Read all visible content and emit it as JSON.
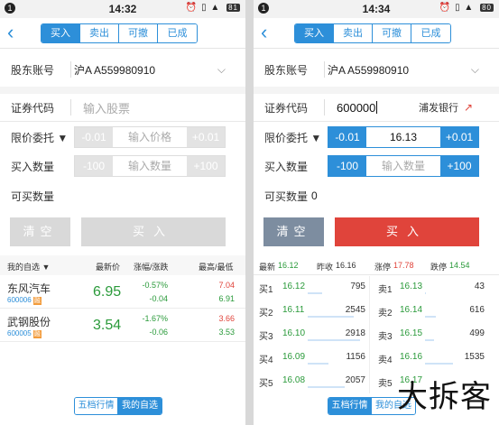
{
  "left": {
    "status": {
      "time": "14:32",
      "battery": "81"
    },
    "tabs": [
      "买入",
      "卖出",
      "可撤",
      "已成"
    ],
    "account_label": "股东账号",
    "account_value": "沪A A559980910",
    "code_label": "证券代码",
    "code_placeholder": "输入股票",
    "limit_label": "限价委托 ▼",
    "price_minus": "-0.01",
    "price_placeholder": "输入价格",
    "price_plus": "+0.01",
    "qty_label": "买入数量",
    "qty_minus": "-100",
    "qty_placeholder": "输入数量",
    "qty_plus": "+100",
    "avail_label": "可买数量",
    "clear_label": "清空",
    "buy_label": "买入",
    "watchlist": {
      "header": {
        "mine": "我的自选 ▼",
        "latest": "最新价",
        "change": "涨幅/涨跌",
        "highlow": "最高/最低"
      },
      "rows": [
        {
          "name": "东风汽车",
          "code": "600006",
          "badge": "融",
          "price": "6.95",
          "pct": "-0.57%",
          "chg": "-0.04",
          "high": "7.04",
          "low": "6.91"
        },
        {
          "name": "武钢股份",
          "code": "600005",
          "badge": "融",
          "price": "3.54",
          "pct": "-1.67%",
          "chg": "-0.06",
          "high": "3.66",
          "low": "3.53"
        }
      ]
    },
    "bottom_tabs": [
      "五档行情",
      "我的自选"
    ]
  },
  "right": {
    "status": {
      "time": "14:34",
      "battery": "80"
    },
    "tabs": [
      "买入",
      "卖出",
      "可撤",
      "已成"
    ],
    "account_label": "股东账号",
    "account_value": "沪A A559980910",
    "code_label": "证券代码",
    "code_value": "600000",
    "stock_name": "浦发银行",
    "limit_label": "限价委托 ▼",
    "price_minus": "-0.01",
    "price_value": "16.13",
    "price_plus": "+0.01",
    "qty_label": "买入数量",
    "qty_minus": "-100",
    "qty_placeholder": "输入数量",
    "qty_plus": "+100",
    "avail_label": "可买数量",
    "avail_value": "0",
    "clear_label": "清空",
    "buy_label": "买入",
    "quote": {
      "latest_label": "最新",
      "latest": "16.12",
      "prev_label": "昨收",
      "prev": "16.16",
      "up_label": "涨停",
      "up": "17.78",
      "down_label": "跌停",
      "down": "14.54"
    },
    "bids": [
      {
        "label": "买1",
        "price": "16.12",
        "vol": "795"
      },
      {
        "label": "买2",
        "price": "16.11",
        "vol": "2545"
      },
      {
        "label": "买3",
        "price": "16.10",
        "vol": "2918"
      },
      {
        "label": "买4",
        "price": "16.09",
        "vol": "1156"
      },
      {
        "label": "买5",
        "price": "16.08",
        "vol": "2057"
      }
    ],
    "asks": [
      {
        "label": "卖1",
        "price": "16.13",
        "vol": "43"
      },
      {
        "label": "卖2",
        "price": "16.14",
        "vol": "616"
      },
      {
        "label": "卖3",
        "price": "16.15",
        "vol": "499"
      },
      {
        "label": "卖4",
        "price": "16.16",
        "vol": "1535"
      },
      {
        "label": "卖5",
        "price": "16.17",
        "vol": ""
      }
    ],
    "bottom_tabs": [
      "五档行情",
      "我的自选"
    ]
  },
  "watermark": "大拆客",
  "colors": {
    "accent": "#2d8fd9",
    "buy_red": "#e0443b",
    "clear_gray": "#7d8da0",
    "down_green": "#2a9a3a",
    "disabled": "#d9d9d9"
  }
}
